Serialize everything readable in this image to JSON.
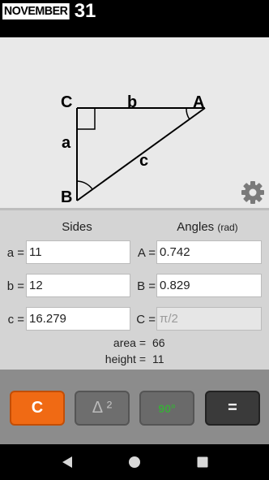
{
  "header": {
    "month": "NOVEMBER",
    "day": "31"
  },
  "diagram": {
    "vertex_labels": {
      "C": "C",
      "A": "A",
      "B": "B"
    },
    "side_labels": {
      "a": "a",
      "b": "b",
      "c": "c"
    }
  },
  "panel": {
    "sides_heading": "Sides",
    "angles_heading": "Angles",
    "angles_unit": "(rad)",
    "sides": [
      {
        "label": "a =",
        "value": "11"
      },
      {
        "label": "b =",
        "value": "12"
      },
      {
        "label": "c =",
        "value": "16.279"
      }
    ],
    "angles": [
      {
        "label": "A =",
        "value": "0.742"
      },
      {
        "label": "B =",
        "value": "0.829"
      },
      {
        "label": "C =",
        "value": "π/2"
      }
    ],
    "area_label": "area =",
    "area_value": "66",
    "height_label": "height =",
    "height_value": "11"
  },
  "buttons": {
    "clear": "C",
    "delta": "Δ ²",
    "degrees": "90°",
    "equals": "="
  },
  "icons": {
    "settings": "gear-icon",
    "back": "back-triangle-icon",
    "home": "home-circle-icon",
    "recents": "recents-square-icon"
  },
  "colors": {
    "accent": "#f06a14",
    "diagram_bg": "#e9e9e9",
    "panel_bg": "#d4d4d4",
    "button_bar_bg": "#8c8c8c"
  }
}
